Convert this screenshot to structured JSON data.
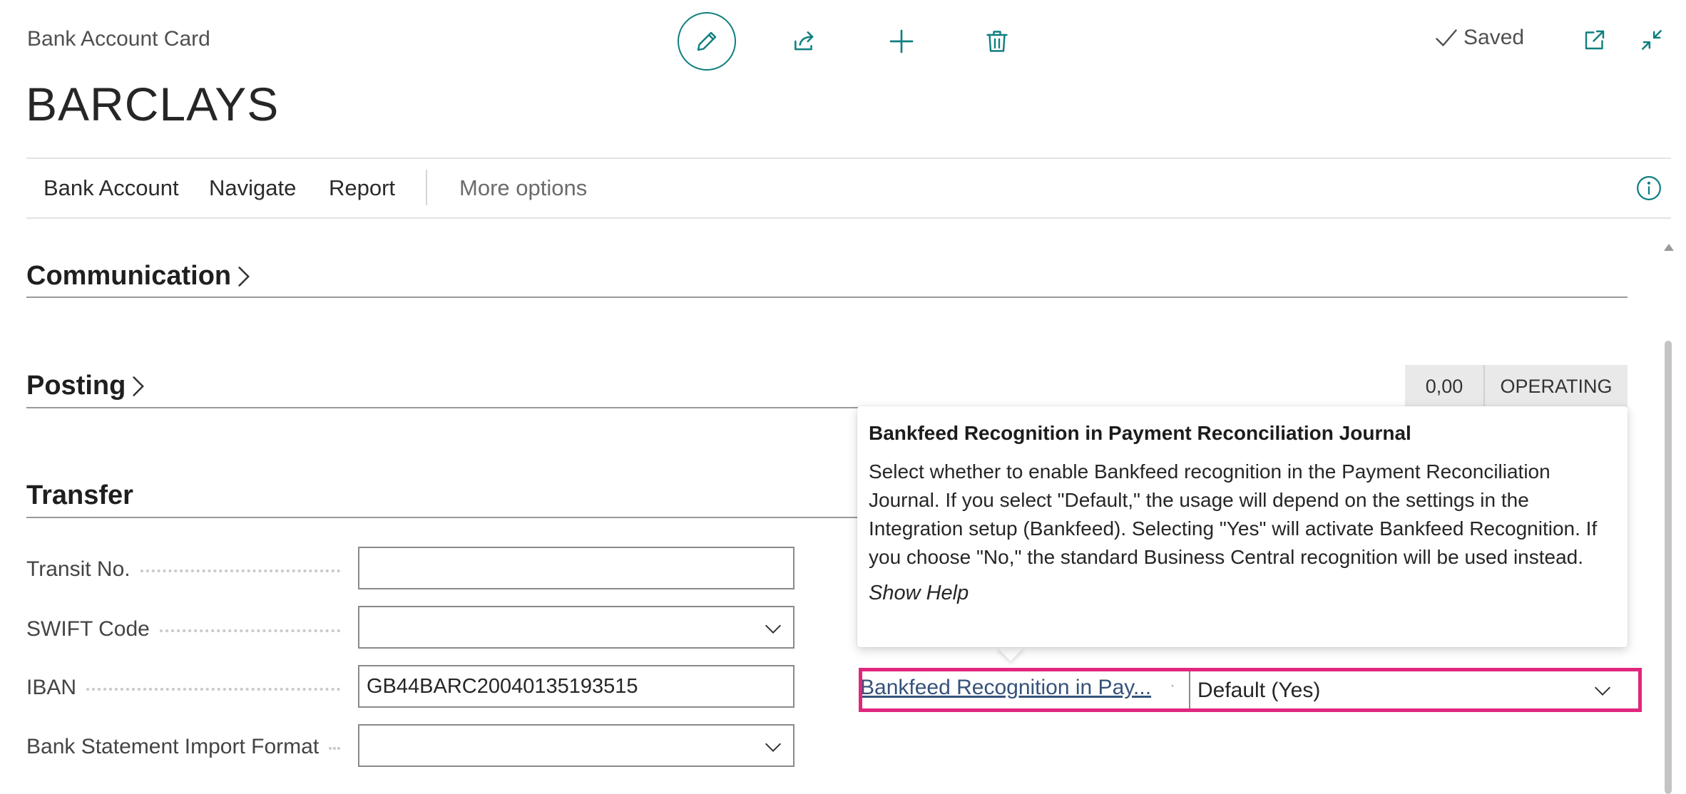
{
  "header": {
    "page_kind": "Bank Account Card",
    "title": "BARCLAYS",
    "saved_label": "Saved"
  },
  "actions": {
    "bank_account": "Bank Account",
    "navigate": "Navigate",
    "report": "Report",
    "more_options": "More options"
  },
  "sections": {
    "communication": "Communication",
    "posting": "Posting",
    "transfer": "Transfer"
  },
  "posting_badges": [
    "0,00",
    "OPERATING"
  ],
  "fields": {
    "transit_no": {
      "label": "Transit No.",
      "value": ""
    },
    "swift_code": {
      "label": "SWIFT Code",
      "value": ""
    },
    "iban": {
      "label": "IBAN",
      "value": "GB44BARC20040135193515"
    },
    "bank_statement_import_format": {
      "label": "Bank Statement Import Format",
      "value": ""
    },
    "bankfeed_recognition": {
      "label": "Bankfeed Recognition in Pay...",
      "value": "Default (Yes)"
    }
  },
  "tooltip": {
    "title": "Bankfeed Recognition in Payment Reconciliation Journal",
    "body": "Select whether to enable Bankfeed recognition in the Payment Reconciliation Journal. If you select \"Default,\" the usage will depend on the settings in the Integration setup (Bankfeed). Selecting \"Yes\" will activate Bankfeed Recognition. If you choose \"No,\" the standard Business Central recognition will be used instead.",
    "show_help": "Show Help"
  },
  "icons": {
    "edit": "pencil-icon",
    "share": "share-icon",
    "add": "plus-icon",
    "delete": "trash-icon",
    "saved": "checkmark-icon",
    "popout": "open-in-new-window-icon",
    "collapse": "collapse-icon",
    "info": "info-icon"
  },
  "colors": {
    "accent": "#0f7f7f",
    "highlight": "#e0267d",
    "link": "#36527a"
  }
}
